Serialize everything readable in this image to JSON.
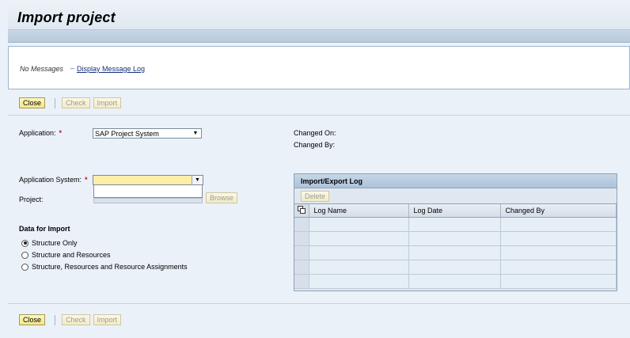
{
  "header": {
    "title": "Import project"
  },
  "messages": {
    "status": "No Messages",
    "separator": "–",
    "log_link": "Display Message Log"
  },
  "toolbar": {
    "close": "Close",
    "check": "Check",
    "import": "Import"
  },
  "form": {
    "application_label": "Application:",
    "application_value": "SAP Project System",
    "changed_on_label": "Changed On:",
    "changed_by_label": "Changed By:",
    "app_system_label": "Application System:",
    "app_system_value": "",
    "project_label": "Project:",
    "browse": "Browse",
    "required_mark": "*"
  },
  "import_data": {
    "title": "Data for Import",
    "options": [
      {
        "label": "Structure Only",
        "selected": true
      },
      {
        "label": "Structure and Resources",
        "selected": false
      },
      {
        "label": "Structure, Resources and Resource Assignments",
        "selected": false
      }
    ]
  },
  "log_panel": {
    "title": "Import/Export Log",
    "delete": "Delete",
    "columns": [
      "Log Name",
      "Log Date",
      "Changed By"
    ],
    "rows": 5
  },
  "colors": {
    "accent_button": "#f3e68a",
    "required_field": "#ffeea8",
    "required_mark": "#c8102e"
  }
}
